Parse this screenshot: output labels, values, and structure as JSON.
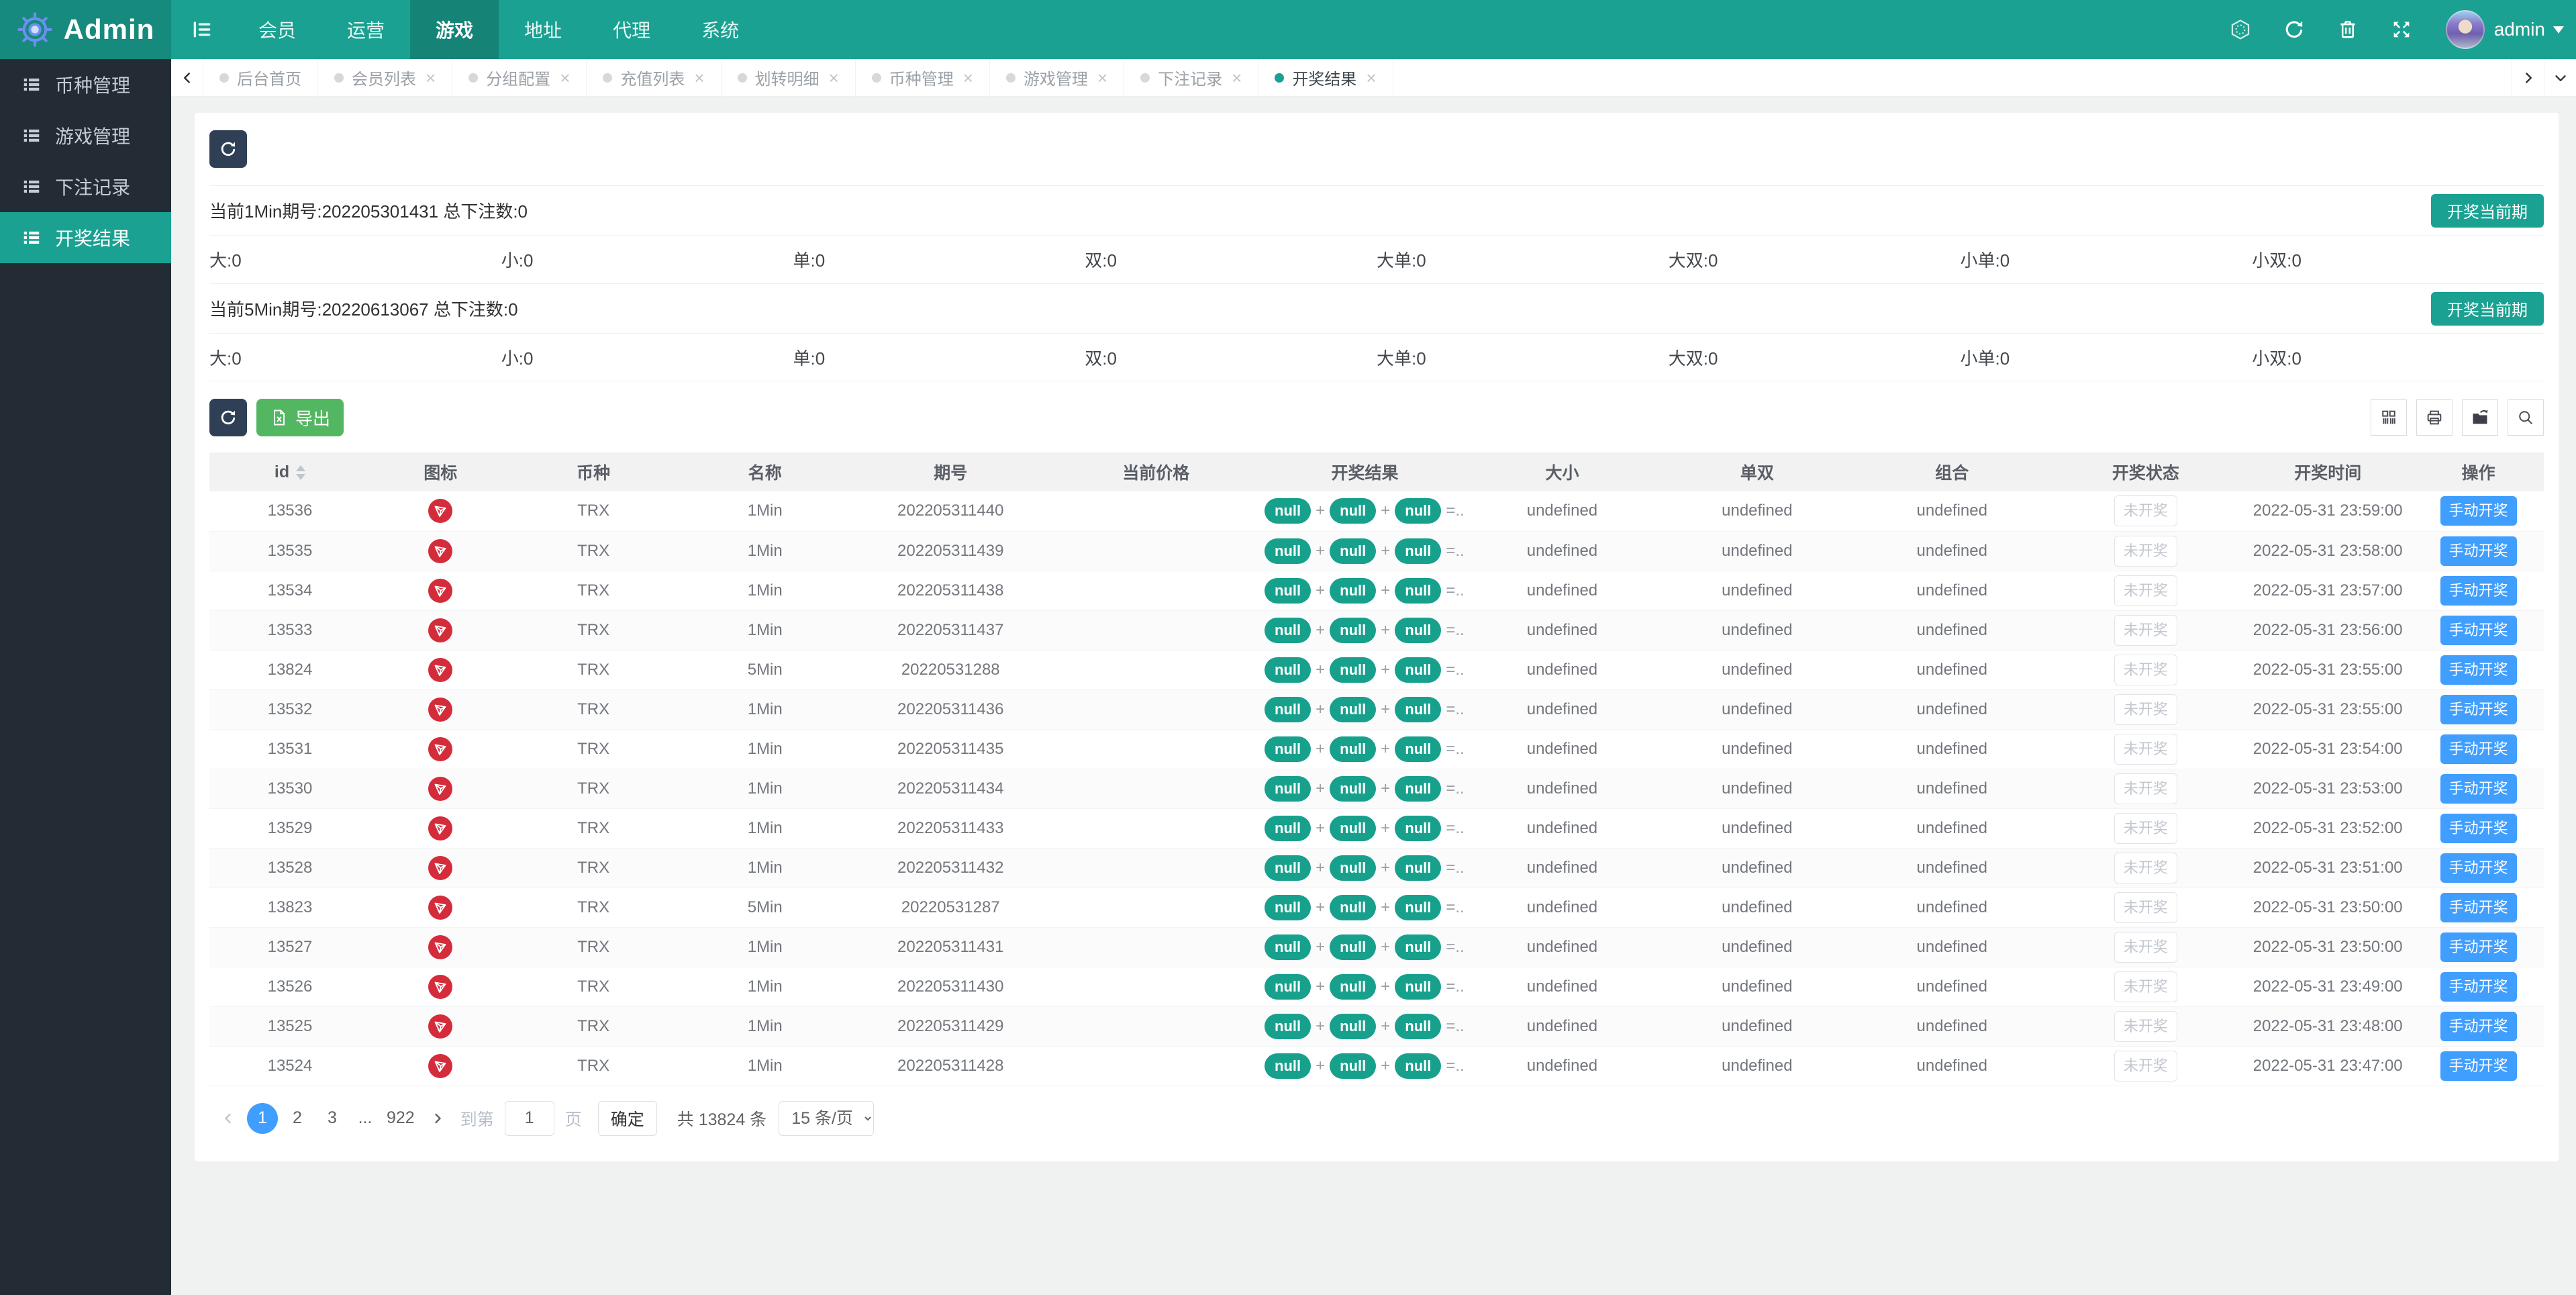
{
  "colors": {
    "accent_teal": "#1aa192",
    "primary_blue": "#409eff",
    "export_green": "#53b761",
    "navy": "#2f4056",
    "tron_red": "#d42c3b",
    "sidebar_bg": "#232c35"
  },
  "icons": {
    "close-icon": "×",
    "dot-icon": "circle",
    "sort-icon": "up-down-triangles",
    "list-icon": "bulleted-list",
    "gear-logo-icon": "gear",
    "menu-toggle-icon": "hamburger",
    "hexagon-icon": "hexagon",
    "refresh-icon": "circular-arrows",
    "trash-icon": "trash-can",
    "fullscreen-icon": "expand-arrows",
    "caret-down-icon": "▼",
    "chevron-left-icon": "‹",
    "chevron-right-icon": "›",
    "chevron-down-icon": "⌄",
    "excel-icon": "spreadsheet-file",
    "columns-icon": "grid-columns",
    "printer-icon": "printer",
    "export-folder-icon": "folder-arrow",
    "search-icon": "magnifier",
    "trx-icon": "tron-logo"
  },
  "navbar": {
    "brand": "Admin",
    "menu": [
      {
        "label": "会员"
      },
      {
        "label": "运营"
      },
      {
        "label": "游戏",
        "active": true
      },
      {
        "label": "地址"
      },
      {
        "label": "代理"
      },
      {
        "label": "系统"
      }
    ],
    "user": "admin"
  },
  "sidebar": {
    "items": [
      {
        "label": "币种管理"
      },
      {
        "label": "游戏管理"
      },
      {
        "label": "下注记录"
      },
      {
        "label": "开奖结果",
        "active": true
      }
    ]
  },
  "tabbar": {
    "tabs": [
      {
        "label": "后台首页",
        "closable": false
      },
      {
        "label": "会员列表",
        "closable": true
      },
      {
        "label": "分组配置",
        "closable": true
      },
      {
        "label": "充值列表",
        "closable": true
      },
      {
        "label": "划转明细",
        "closable": true
      },
      {
        "label": "币种管理",
        "closable": true
      },
      {
        "label": "游戏管理",
        "closable": true
      },
      {
        "label": "下注记录",
        "closable": true
      },
      {
        "label": "开奖结果",
        "closable": true,
        "active": true
      }
    ]
  },
  "sections": [
    {
      "title": "当前1Min期号:202205301431 总下注数:0",
      "button": "开奖当前期",
      "stats": [
        "大:0",
        "小:0",
        "单:0",
        "双:0",
        "大单:0",
        "大双:0",
        "小单:0",
        "小双:0"
      ]
    },
    {
      "title": "当前5Min期号:20220613067 总下注数:0",
      "button": "开奖当前期",
      "stats": [
        "大:0",
        "小:0",
        "单:0",
        "双:0",
        "大单:0",
        "大双:0",
        "小单:0",
        "小双:0"
      ]
    }
  ],
  "toolbar": {
    "export_label": "导出"
  },
  "table": {
    "headers": [
      "id",
      "图标",
      "币种",
      "名称",
      "期号",
      "当前价格",
      "开奖结果",
      "大小",
      "单双",
      "组合",
      "开奖状态",
      "开奖时间",
      "操作"
    ],
    "result": {
      "pill": "null",
      "sep": "+",
      "tail": "=..."
    },
    "rows": [
      {
        "id": "13536",
        "coin": "TRX",
        "name": "1Min",
        "issue": "202205311440",
        "price": "",
        "size": "undefined",
        "oddeven": "undefined",
        "combo": "undefined",
        "status": "未开奖",
        "time": "2022-05-31 23:59:00",
        "action": "手动开奖"
      },
      {
        "id": "13535",
        "coin": "TRX",
        "name": "1Min",
        "issue": "202205311439",
        "price": "",
        "size": "undefined",
        "oddeven": "undefined",
        "combo": "undefined",
        "status": "未开奖",
        "time": "2022-05-31 23:58:00",
        "action": "手动开奖"
      },
      {
        "id": "13534",
        "coin": "TRX",
        "name": "1Min",
        "issue": "202205311438",
        "price": "",
        "size": "undefined",
        "oddeven": "undefined",
        "combo": "undefined",
        "status": "未开奖",
        "time": "2022-05-31 23:57:00",
        "action": "手动开奖"
      },
      {
        "id": "13533",
        "coin": "TRX",
        "name": "1Min",
        "issue": "202205311437",
        "price": "",
        "size": "undefined",
        "oddeven": "undefined",
        "combo": "undefined",
        "status": "未开奖",
        "time": "2022-05-31 23:56:00",
        "action": "手动开奖"
      },
      {
        "id": "13824",
        "coin": "TRX",
        "name": "5Min",
        "issue": "20220531288",
        "price": "",
        "size": "undefined",
        "oddeven": "undefined",
        "combo": "undefined",
        "status": "未开奖",
        "time": "2022-05-31 23:55:00",
        "action": "手动开奖"
      },
      {
        "id": "13532",
        "coin": "TRX",
        "name": "1Min",
        "issue": "202205311436",
        "price": "",
        "size": "undefined",
        "oddeven": "undefined",
        "combo": "undefined",
        "status": "未开奖",
        "time": "2022-05-31 23:55:00",
        "action": "手动开奖"
      },
      {
        "id": "13531",
        "coin": "TRX",
        "name": "1Min",
        "issue": "202205311435",
        "price": "",
        "size": "undefined",
        "oddeven": "undefined",
        "combo": "undefined",
        "status": "未开奖",
        "time": "2022-05-31 23:54:00",
        "action": "手动开奖"
      },
      {
        "id": "13530",
        "coin": "TRX",
        "name": "1Min",
        "issue": "202205311434",
        "price": "",
        "size": "undefined",
        "oddeven": "undefined",
        "combo": "undefined",
        "status": "未开奖",
        "time": "2022-05-31 23:53:00",
        "action": "手动开奖"
      },
      {
        "id": "13529",
        "coin": "TRX",
        "name": "1Min",
        "issue": "202205311433",
        "price": "",
        "size": "undefined",
        "oddeven": "undefined",
        "combo": "undefined",
        "status": "未开奖",
        "time": "2022-05-31 23:52:00",
        "action": "手动开奖"
      },
      {
        "id": "13528",
        "coin": "TRX",
        "name": "1Min",
        "issue": "202205311432",
        "price": "",
        "size": "undefined",
        "oddeven": "undefined",
        "combo": "undefined",
        "status": "未开奖",
        "time": "2022-05-31 23:51:00",
        "action": "手动开奖"
      },
      {
        "id": "13823",
        "coin": "TRX",
        "name": "5Min",
        "issue": "20220531287",
        "price": "",
        "size": "undefined",
        "oddeven": "undefined",
        "combo": "undefined",
        "status": "未开奖",
        "time": "2022-05-31 23:50:00",
        "action": "手动开奖"
      },
      {
        "id": "13527",
        "coin": "TRX",
        "name": "1Min",
        "issue": "202205311431",
        "price": "",
        "size": "undefined",
        "oddeven": "undefined",
        "combo": "undefined",
        "status": "未开奖",
        "time": "2022-05-31 23:50:00",
        "action": "手动开奖"
      },
      {
        "id": "13526",
        "coin": "TRX",
        "name": "1Min",
        "issue": "202205311430",
        "price": "",
        "size": "undefined",
        "oddeven": "undefined",
        "combo": "undefined",
        "status": "未开奖",
        "time": "2022-05-31 23:49:00",
        "action": "手动开奖"
      },
      {
        "id": "13525",
        "coin": "TRX",
        "name": "1Min",
        "issue": "202205311429",
        "price": "",
        "size": "undefined",
        "oddeven": "undefined",
        "combo": "undefined",
        "status": "未开奖",
        "time": "2022-05-31 23:48:00",
        "action": "手动开奖"
      },
      {
        "id": "13524",
        "coin": "TRX",
        "name": "1Min",
        "issue": "202205311428",
        "price": "",
        "size": "undefined",
        "oddeven": "undefined",
        "combo": "undefined",
        "status": "未开奖",
        "time": "2022-05-31 23:47:00",
        "action": "手动开奖"
      }
    ]
  },
  "pagination": {
    "pages": [
      "1",
      "2",
      "3",
      "...",
      "922"
    ],
    "active": "1",
    "goto_prefix": "到第",
    "goto_value": "1",
    "goto_suffix": "页",
    "confirm": "确定",
    "total": "共 13824 条",
    "page_size": "15 条/页"
  }
}
